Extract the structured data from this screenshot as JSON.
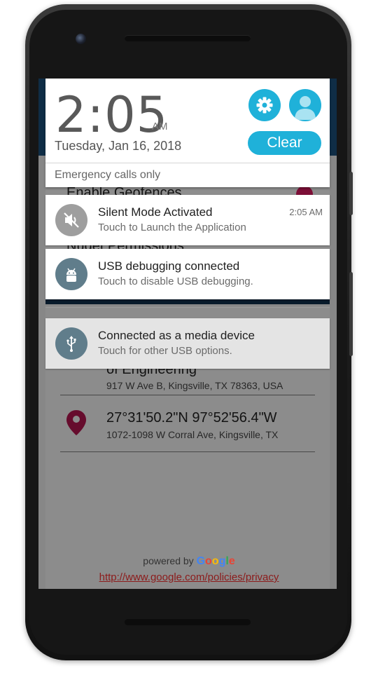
{
  "shade": {
    "time": "2:05",
    "ampm": "AM",
    "date": "Tuesday, Jan 16, 2018",
    "clear_label": "Clear",
    "emergency": "Emergency calls only"
  },
  "background_app": {
    "partial_row_1": "Enable Geofences",
    "partial_row_2": "Nuget Permissions",
    "partial_title_3": "of Engineering",
    "address_3": "917 W Ave B, Kingsville, TX 78363, USA",
    "coords_4": "27°31'50.2\"N 97°52'56.4\"W",
    "address_4": "1072-1098 W Corral Ave, Kingsville, TX",
    "powered_by": "powered by",
    "google_letters": [
      "G",
      "o",
      "o",
      "g",
      "l",
      "e"
    ],
    "google_colors": [
      "#4285F4",
      "#EA4335",
      "#FBBC05",
      "#4285F4",
      "#34A853",
      "#EA4335"
    ],
    "privacy_link": "http://www.google.com/policies/privacy"
  },
  "notifications": [
    {
      "title": "Silent Mode Activated",
      "text": "Touch to Launch the Application",
      "time": "2:05 AM",
      "icon": "volume-off-icon",
      "icon_color": "#9e9e9e"
    },
    {
      "title": "USB debugging connected",
      "text": "Touch to disable USB debugging.",
      "icon": "android-icon",
      "icon_color": "#607d8b"
    },
    {
      "title": "Connected as a media device",
      "text": "Touch for other USB options.",
      "icon": "usb-icon",
      "icon_color": "#607d8b"
    }
  ],
  "colors": {
    "accent": "#1fb1d9",
    "pin": "#b0164e",
    "header": "#1b4f79"
  }
}
